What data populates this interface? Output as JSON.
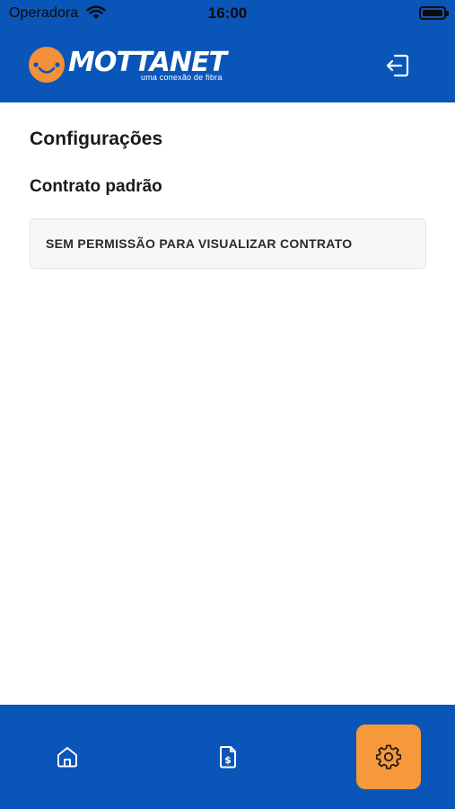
{
  "status_bar": {
    "carrier": "Operadora",
    "time": "16:00",
    "wifi_icon": "wifi-icon",
    "battery_icon": "battery-icon"
  },
  "header": {
    "logo_text": "MOTTANET",
    "logo_tagline": "uma conexão de fibra",
    "logout_icon": "logout-icon",
    "colors": {
      "background": "#0a55b8",
      "logo_accent": "#f3913a"
    }
  },
  "main": {
    "title": "Configurações",
    "section_title": "Contrato padrão",
    "contract_message": "SEM PERMISSÃO PARA VISUALIZAR CONTRATO"
  },
  "bottom_nav": {
    "items": [
      {
        "icon": "home-icon",
        "active": false
      },
      {
        "icon": "invoice-icon",
        "active": false
      },
      {
        "icon": "gear-icon",
        "active": true
      }
    ],
    "colors": {
      "background": "#0a55b8",
      "active": "#f6993a"
    }
  }
}
